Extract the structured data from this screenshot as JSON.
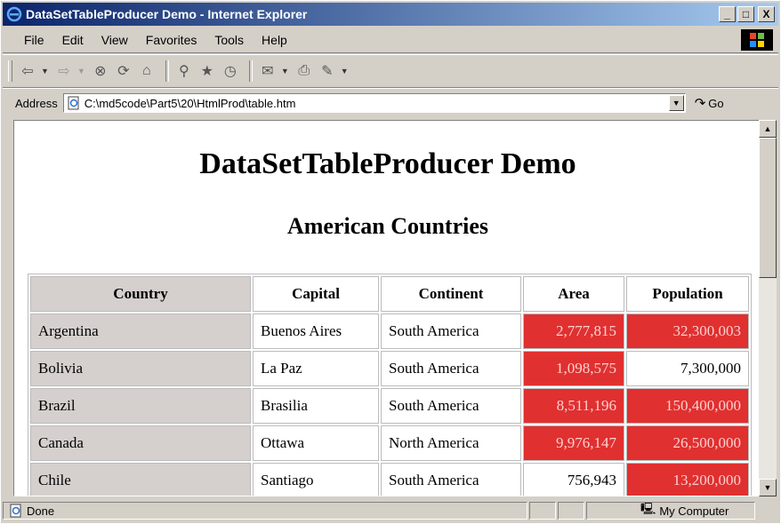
{
  "window": {
    "title": "DataSetTableProducer Demo - Internet Explorer",
    "controls": {
      "minimize": "_",
      "maximize": "□",
      "close": "X"
    }
  },
  "menu": {
    "items": [
      {
        "label": "File"
      },
      {
        "label": "Edit"
      },
      {
        "label": "View"
      },
      {
        "label": "Favorites"
      },
      {
        "label": "Tools"
      },
      {
        "label": "Help"
      }
    ]
  },
  "toolbar": {
    "buttons": [
      "back-icon",
      "forward-icon",
      "stop-icon",
      "refresh-icon",
      "home-icon",
      "search-icon",
      "favorites-icon",
      "history-icon",
      "mail-icon",
      "print-icon",
      "edit-icon"
    ]
  },
  "address": {
    "label": "Address",
    "value": "C:\\md5code\\Part5\\20\\HtmlProd\\table.htm",
    "go_label": "Go"
  },
  "page": {
    "heading": "DataSetTableProducer Demo",
    "subheading": "American Countries"
  },
  "table": {
    "headers": [
      "Country",
      "Capital",
      "Continent",
      "Area",
      "Population"
    ],
    "rows": [
      {
        "country": "Argentina",
        "capital": "Buenos Aires",
        "continent": "South America",
        "area": "2,777,815",
        "population": "32,300,003",
        "area_highlight": true,
        "population_highlight": true
      },
      {
        "country": "Bolivia",
        "capital": "La Paz",
        "continent": "South America",
        "area": "1,098,575",
        "population": "7,300,000",
        "area_highlight": true,
        "population_highlight": false
      },
      {
        "country": "Brazil",
        "capital": "Brasilia",
        "continent": "South America",
        "area": "8,511,196",
        "population": "150,400,000",
        "area_highlight": true,
        "population_highlight": true
      },
      {
        "country": "Canada",
        "capital": "Ottawa",
        "continent": "North America",
        "area": "9,976,147",
        "population": "26,500,000",
        "area_highlight": true,
        "population_highlight": true
      },
      {
        "country": "Chile",
        "capital": "Santiago",
        "continent": "South America",
        "area": "756,943",
        "population": "13,200,000",
        "area_highlight": false,
        "population_highlight": true
      }
    ]
  },
  "status": {
    "text": "Done",
    "zone": "My Computer"
  },
  "colors": {
    "highlight": "#e03030",
    "first_column": "#d5d0cd",
    "titlebar": "#0a246a"
  }
}
